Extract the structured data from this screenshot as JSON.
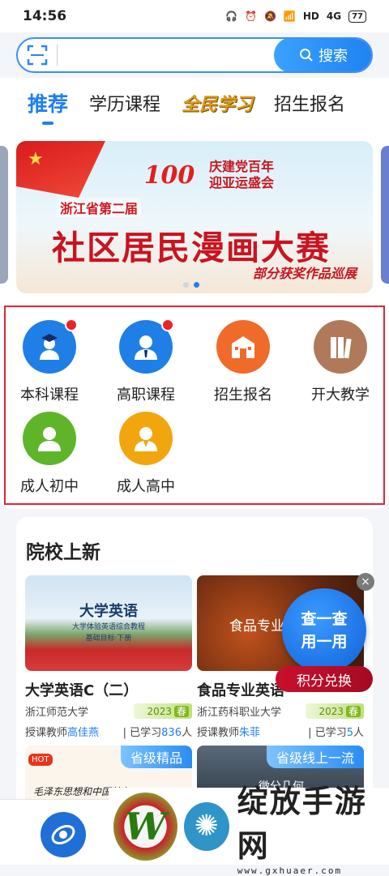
{
  "status_bar": {
    "time": "14:56",
    "icons": [
      "headset-icon",
      "alarm-icon",
      "mute-icon",
      "wifi-icon",
      "hd-icon",
      "4g-icon"
    ],
    "battery": "77"
  },
  "search": {
    "button_label": "搜索",
    "placeholder": ""
  },
  "tabs": [
    {
      "label": "推荐",
      "active": true
    },
    {
      "label": "学历课程",
      "active": false
    },
    {
      "label": "全民学习",
      "active": false
    },
    {
      "label": "招生报名",
      "active": false
    }
  ],
  "banner": {
    "badge": "100",
    "slogan_line1": "庆建党百年",
    "slogan_line2": "迎亚运盛会",
    "subtitle": "浙江省第二届",
    "title": "社区居民漫画大赛",
    "footer": "部分获奖作品巡展",
    "slides": 2,
    "current_slide": 2
  },
  "quick_links": [
    {
      "label": "本科课程",
      "color": "#1f7fe6",
      "badge": true,
      "icon": "graduate-icon"
    },
    {
      "label": "高职课程",
      "color": "#1f7fe6",
      "badge": true,
      "icon": "person-tie-icon"
    },
    {
      "label": "招生报名",
      "color": "#f06a2a",
      "badge": false,
      "icon": "school-building-icon"
    },
    {
      "label": "开大教学",
      "color": "#b07a5a",
      "badge": false,
      "icon": "books-icon"
    },
    {
      "label": "成人初中",
      "color": "#5fb52a",
      "badge": false,
      "icon": "person-icon"
    },
    {
      "label": "成人高中",
      "color": "#f2a60d",
      "badge": false,
      "icon": "person-suit-icon"
    }
  ],
  "section": {
    "title": "院校上新"
  },
  "courses": [
    {
      "title": "大学英语C（二）",
      "school": "浙江师范大学",
      "year": "2023",
      "season": "春",
      "teacher_label": "授课教师",
      "teacher": "高佳燕",
      "studied_prefix": "已学习",
      "studied": "836",
      "studied_suffix": "人",
      "img_text1": "大学英语",
      "img_text2": "大学体验英语综合教程",
      "img_text3": "基础目标·下册"
    },
    {
      "title": "食品专业英语",
      "school": "浙江药科职业大学",
      "year": "2023",
      "season": "春",
      "teacher_label": "授课教师",
      "teacher": "朱菲",
      "studied_prefix": "已学习",
      "studied": "5",
      "studied_suffix": "人",
      "img_text1": "食品专业"
    }
  ],
  "next_courses": [
    {
      "ribbon": "省级精品",
      "tag": "HOT",
      "img_text": "毛泽东思想和中国特色"
    },
    {
      "ribbon": "省级线上一流",
      "img_text": "微分几何"
    }
  ],
  "float": {
    "line1": "查一查",
    "line2": "用一用",
    "pill": "积分兑换",
    "close": "×"
  },
  "watermark": {
    "big": "绽放手游网",
    "url": "www.gxhuaer.com",
    "logo_letter": "W"
  }
}
